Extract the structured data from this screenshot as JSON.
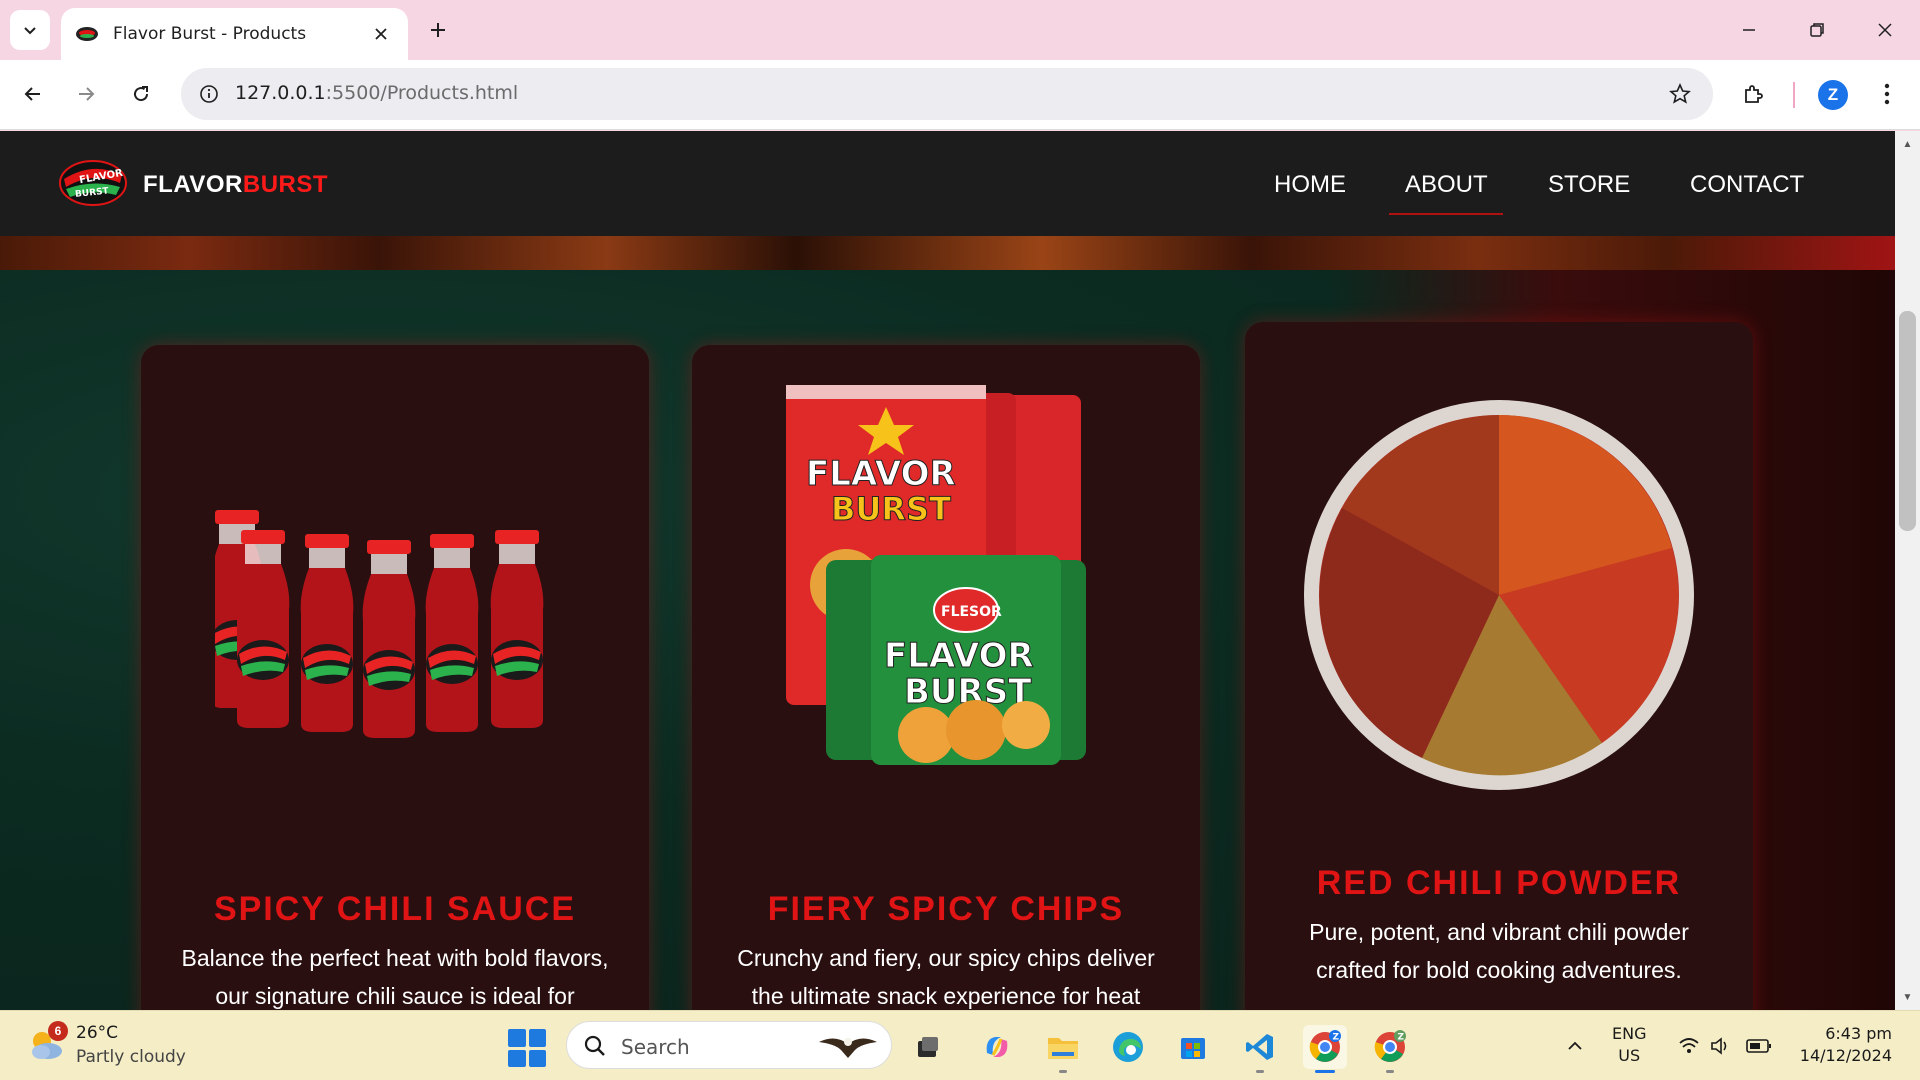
{
  "browser": {
    "tab_title": "Flavor Burst - Products",
    "url_host": "127.0.0.1",
    "url_rest": ":5500/Products.html",
    "profile_initial": "Z"
  },
  "site": {
    "brand_white": "FLAVOR",
    "brand_red": "BURST",
    "nav": [
      {
        "label": "HOME"
      },
      {
        "label": "ABOUT",
        "active": true
      },
      {
        "label": "STORE"
      },
      {
        "label": "CONTACT"
      }
    ],
    "accent_color": "#e01414"
  },
  "products": [
    {
      "title": "SPICY CHILI SAUCE",
      "desc_line1": "Balance the perfect heat with bold flavors,",
      "desc_line2": "our signature chili sauce is ideal for",
      "image": "chili-sauce-bottles"
    },
    {
      "title": "FIERY SPICY CHIPS",
      "desc_line1": "Crunchy and fiery, our spicy chips deliver",
      "desc_line2": "the ultimate snack experience for heat",
      "image": "chips-bags",
      "bag_text_1": "FLAVOR",
      "bag_text_2": "BURST",
      "bag_badge": "FLESOR"
    },
    {
      "title": "RED CHILI POWDER",
      "desc_line1": "Pure, potent, and vibrant chili powder",
      "desc_line2": "crafted for bold cooking adventures.",
      "image": "chili-powder-bowl"
    }
  ],
  "taskbar": {
    "weather_badge": "6",
    "temperature": "26°C",
    "weather": "Partly cloudy",
    "search_placeholder": "Search",
    "lang_line1": "ENG",
    "lang_line2": "US",
    "time": "6:43 pm",
    "date": "14/12/2024"
  }
}
